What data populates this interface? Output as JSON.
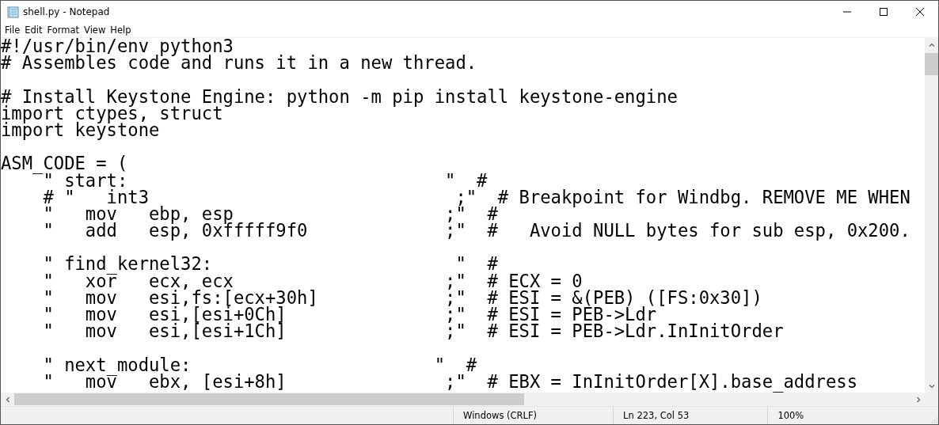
{
  "window": {
    "title": "shell.py - Notepad"
  },
  "menu": [
    "File",
    "Edit",
    "Format",
    "View",
    "Help"
  ],
  "editor": {
    "blocks": [
      [
        "#!/usr/bin/env python3",
        "# Assembles code and runs it in a new thread."
      ],
      [
        "# Install Keystone Engine: python -m pip install keystone-engine",
        "import ctypes, struct",
        "import keystone"
      ],
      [
        "ASM_CODE = (",
        "    \" start:                              \"  #",
        "    # \"   int3                             ;\"  # Breakpoint for Windbg. REMOVE ME WHEN",
        "    \"   mov   ebp, esp                    ;\"  #",
        "    \"   add   esp, 0xfffff9f0             ;\"  #   Avoid NULL bytes for sub esp, 0x200."
      ],
      [
        "    \" find_kernel32:                       \"  #",
        "    \"   xor   ecx, ecx                    ;\"  # ECX = 0",
        "    \"   mov   esi,fs:[ecx+30h]            ;\"  # ESI = &(PEB) ([FS:0x30])",
        "    \"   mov   esi,[esi+0Ch]               ;\"  # ESI = PEB->Ldr",
        "    \"   mov   esi,[esi+1Ch]               ;\"  # ESI = PEB->Ldr.InInitOrder"
      ],
      [
        "    \" next_module:                       \"  #",
        "    \"   mov   ebx, [esi+8h]               ;\"  # EBX = InInitOrder[X].base_address"
      ]
    ]
  },
  "status_bar": [
    "Windows (CRLF)",
    "Ln 223, Col 53",
    "100%"
  ]
}
